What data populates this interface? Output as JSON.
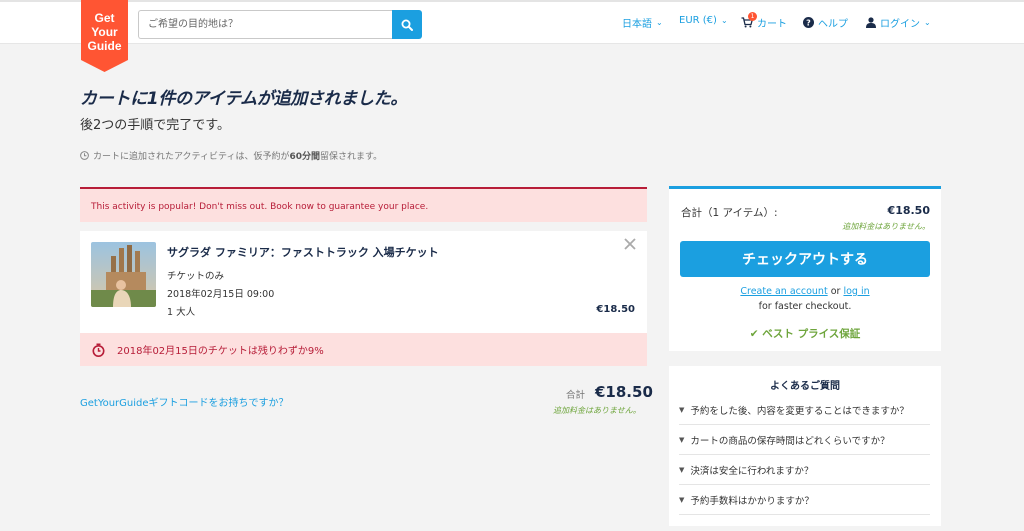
{
  "header": {
    "logo_lines": [
      "Get",
      "Your",
      "Guide"
    ],
    "search_placeholder": "ご希望の目的地は？",
    "language": "日本語",
    "currency": "EUR (€)",
    "cart": "カート",
    "cart_count": "1",
    "help": "ヘルプ",
    "login": "ログイン"
  },
  "page": {
    "title": "カートに1件のアイテムが追加されました。",
    "subtitle": "後2つの手順で完了です。",
    "reserve_prefix": "カートに追加されたアクティビティは、仮予約が",
    "reserve_time": "60分間",
    "reserve_suffix": "留保されます。"
  },
  "cart": {
    "popular_notice": "This activity is popular! Don't miss out. Book now to guarantee your place.",
    "item": {
      "title": "サグラダ ファミリア：ファストトラック 入場チケット",
      "option": "チケットのみ",
      "datetime": "2018年02月15日 09:00",
      "participants": "1 大人",
      "price": "€18.50"
    },
    "scarcity_notice": "2018年02月15日のチケットは残りわずか9%",
    "gift_code_link": "GetYourGuideギフトコードをお持ちですか？",
    "total_label": "合計",
    "total_value": "€18.50",
    "no_extra_fee": "追加料金はありません。"
  },
  "summary": {
    "total_label": "合計（1 アイテム）:",
    "total_value": "€18.50",
    "no_extra_fee": "追加料金はありません。",
    "checkout_button": "チェックアウトする",
    "create_account": "Create an account",
    "or": "or",
    "log_in": "log in",
    "faster_checkout": "for faster checkout.",
    "best_price": "ベスト プライス保証"
  },
  "faq": {
    "title": "よくあるご質問",
    "items": [
      "予約をした後、内容を変更することはできますか？",
      "カートの商品の保存時間はどれくらいですか？",
      "決済は安全に行われますか？",
      "予約手数料はかかりますか？"
    ]
  },
  "colors": {
    "brand_orange": "#ff5533",
    "accent_blue": "#1b9fe0",
    "alert_red": "#b71d38",
    "alert_bg": "#fde0df",
    "success_green": "#6ea53c"
  }
}
